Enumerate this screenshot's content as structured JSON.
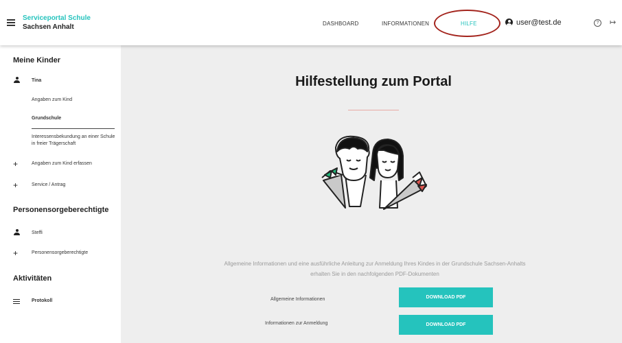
{
  "header": {
    "brand_line1": "Serviceportal Schule",
    "brand_line2": "Sachsen Anhalt",
    "nav": [
      "DASHBOARD",
      "INFORMATIONEN",
      "HILFE"
    ],
    "active_nav": "HILFE",
    "user_email": "user@test.de",
    "icons": [
      "menu-icon",
      "user-icon",
      "help-icon",
      "logout-icon"
    ]
  },
  "sidebar": {
    "children_title": "Meine Kinder",
    "child_name": "Tina",
    "child_items": [
      "Angaben zum Kind",
      "Grundschule",
      "Interessensbekundung an einer Schule in freier Trägerschaft"
    ],
    "add_child": "Angaben zum Kind erfassen",
    "service": "Service / Antrag",
    "guardians_title": "Personensorgeberechtigte",
    "guardian_name": "Steffi",
    "add_guardian": "Personensorgeberechtigte",
    "activities_title": "Aktivitäten",
    "log": "Protokoll"
  },
  "main": {
    "title": "Hilfestellung zum Portal",
    "intro": "Allgemeine Informationen und eine ausführliche Anleitung zur Anmeldung Ihres Kindes in der Grundschule Sachsen-Anhalts erhalten Sie in den nachfolgenden PDF-Dokumenten",
    "downloads": [
      {
        "label": "Allgemeine Informationen",
        "button": "DOWNLOAD PDF"
      },
      {
        "label": "Informationen zur Anmeldung",
        "button": "DOWNLOAD PDF"
      }
    ]
  },
  "colors": {
    "accent": "#25c3bd",
    "highlight_ring": "#a3231c",
    "main_bg": "#eeeeee"
  }
}
